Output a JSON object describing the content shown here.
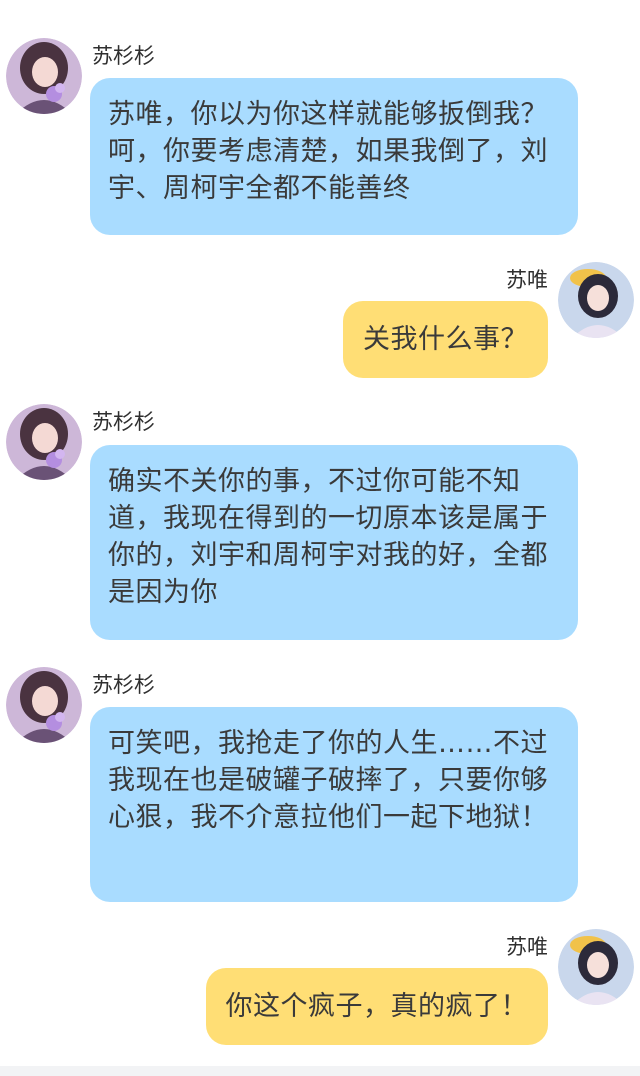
{
  "messages": [
    {
      "side": "left",
      "sender": "苏杉杉",
      "text": "苏唯，你以为你这样就能够扳倒我？呵，你要考虑清楚，如果我倒了，刘宇、周柯宇全都不能善终"
    },
    {
      "side": "right",
      "sender": "苏唯",
      "text": "关我什么事？"
    },
    {
      "side": "left",
      "sender": "苏杉杉",
      "text": "确实不关你的事，不过你可能不知道，我现在得到的一切原本该是属于你的，刘宇和周柯宇对我的好，全都是因为你"
    },
    {
      "side": "left",
      "sender": "苏杉杉",
      "text": "可笑吧，我抢走了你的人生……不过我现在也是破罐子破摔了，只要你够心狠，我不介意拉他们一起下地狱！"
    },
    {
      "side": "right",
      "sender": "苏唯",
      "text": "你这个疯子，真的疯了！"
    }
  ],
  "colors": {
    "left_bubble": "#a9dcff",
    "right_bubble": "#ffde75",
    "text": "#3a3a3a",
    "background": "#ffffff"
  },
  "icons": {
    "left_avatar": "avatar-girl-purple-flowers-icon",
    "right_avatar": "avatar-girl-yellow-hat-icon"
  }
}
